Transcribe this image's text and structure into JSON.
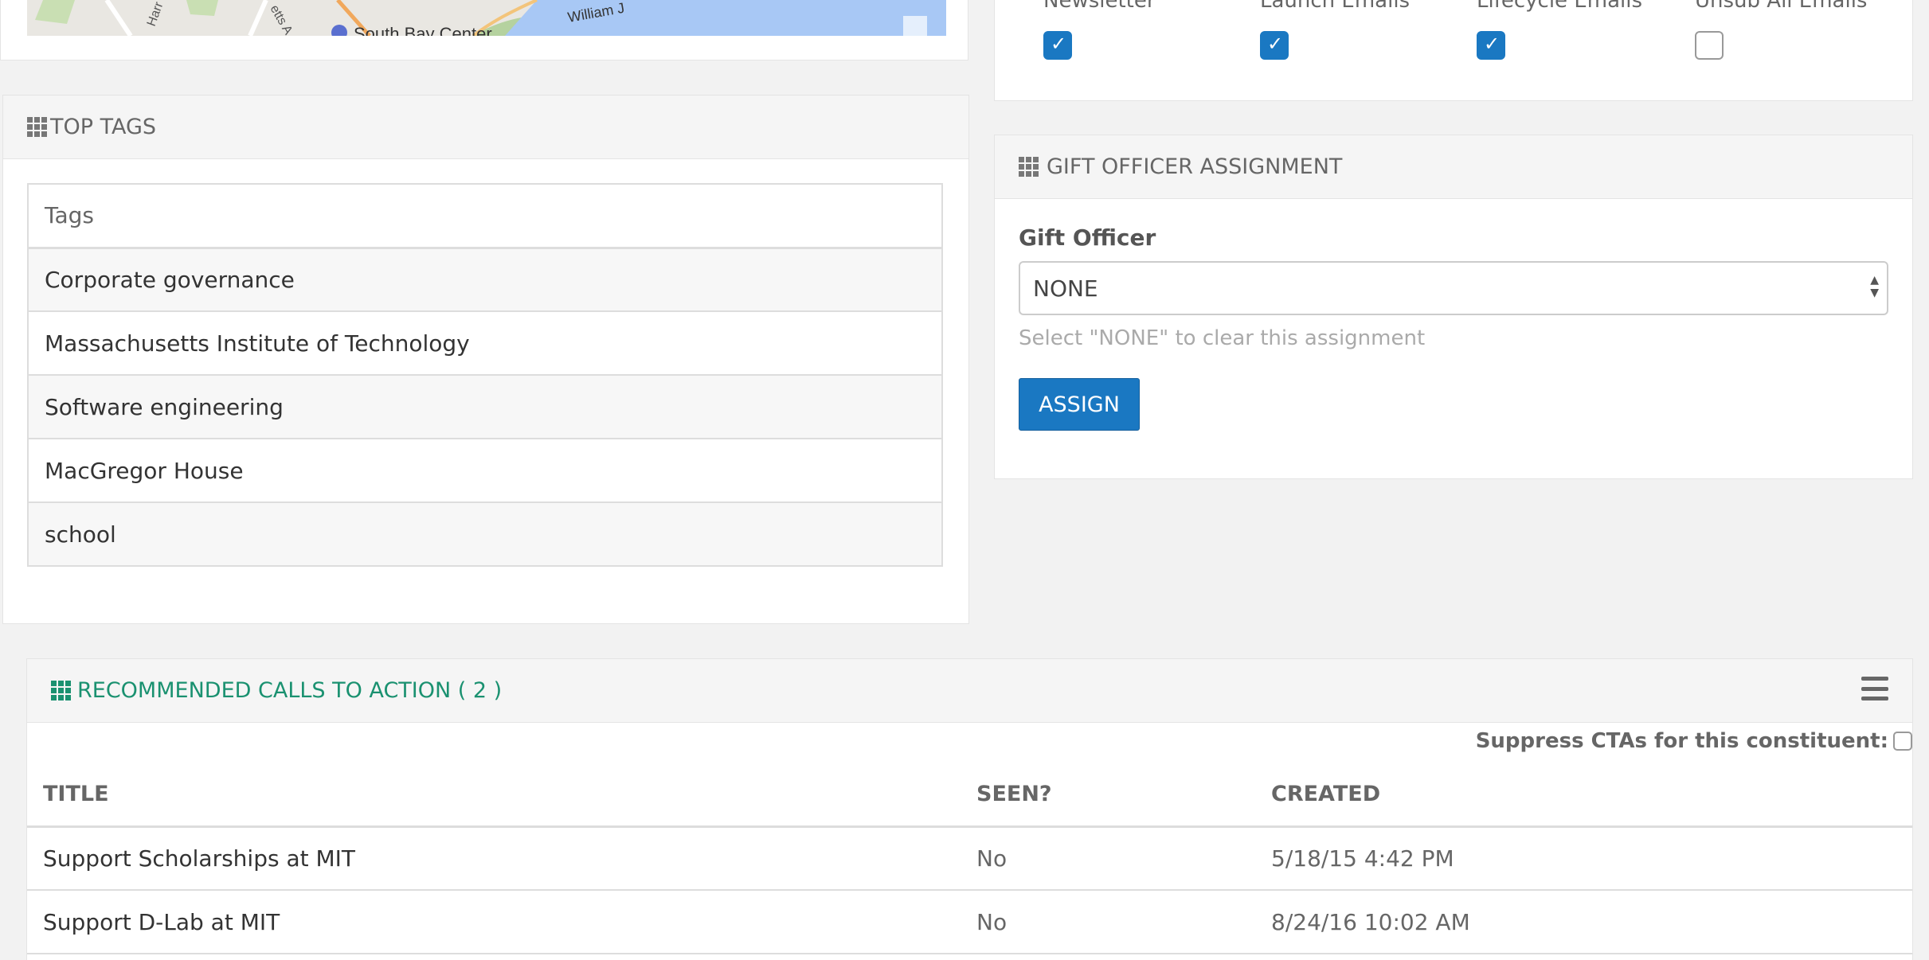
{
  "map": {
    "labels": [
      "South Bay Center",
      "William J",
      "Harr",
      "etts A"
    ]
  },
  "top_tags": {
    "title": "TOP TAGS",
    "header": "Tags",
    "rows": [
      "Corporate governance",
      "Massachusetts Institute of Technology",
      "Software engineering",
      "MacGregor House",
      "school"
    ]
  },
  "email_prefs": {
    "items": [
      {
        "label": "Newsletter",
        "checked": true
      },
      {
        "label": "Launch Emails",
        "checked": true
      },
      {
        "label": "Lifecycle Emails",
        "checked": true
      },
      {
        "label": "Unsub All Emails",
        "checked": false
      }
    ]
  },
  "gift_officer": {
    "title": "GIFT OFFICER ASSIGNMENT",
    "field_label": "Gift Officer",
    "selected": "NONE",
    "help": "Select \"NONE\" to clear this assignment",
    "button": "ASSIGN"
  },
  "cta": {
    "title": "RECOMMENDED CALLS TO ACTION ( 2 )",
    "suppress_label": "Suppress CTAs for this constituent:",
    "columns": [
      "TITLE",
      "SEEN?",
      "CREATED"
    ],
    "rows": [
      {
        "title": "Support Scholarships at MIT",
        "seen": "No",
        "created": "5/18/15 4:42 PM"
      },
      {
        "title": "Support D-Lab at MIT",
        "seen": "No",
        "created": "8/24/16 10:02 AM"
      }
    ]
  },
  "colors": {
    "accent_blue": "#1a78c2",
    "accent_green": "#1a9170"
  }
}
